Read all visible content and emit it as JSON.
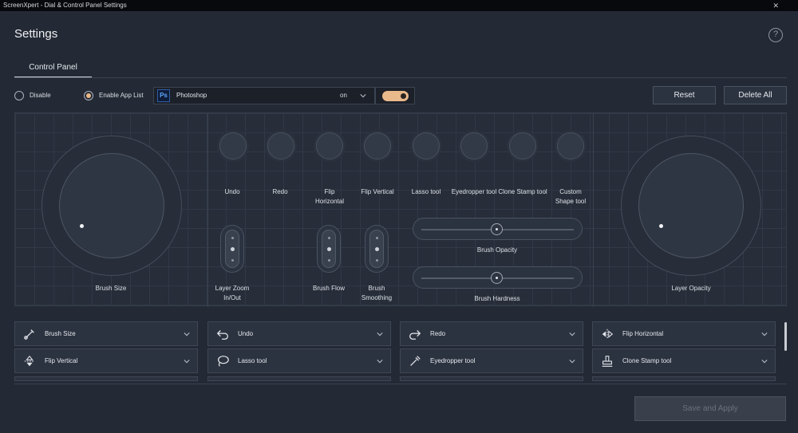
{
  "window": {
    "title": "ScreenXpert - Dial & Control Panel Settings",
    "close_glyph": "✕"
  },
  "header": {
    "title": "Settings",
    "help_glyph": "?"
  },
  "tabs": [
    {
      "label": "Control Panel"
    }
  ],
  "mode": {
    "disable_label": "Disable",
    "enable_app_list_label": "Enable App List",
    "selected": "Enable App List"
  },
  "app_select": {
    "icon_text": "Ps",
    "value": "Photoshop",
    "state": "on"
  },
  "toggle": {
    "on": true
  },
  "buttons": {
    "reset": "Reset",
    "delete_all": "Delete All",
    "save_apply": "Save and Apply"
  },
  "panel": {
    "left_dial": {
      "label": "Brush Size"
    },
    "right_dial": {
      "label": "Layer Opacity"
    },
    "knobs": [
      {
        "label": "Undo"
      },
      {
        "label": "Redo"
      },
      {
        "label": "Flip Horizontal"
      },
      {
        "label": "Flip Vertical"
      },
      {
        "label": "Lasso tool"
      },
      {
        "label": "Eyedropper tool"
      },
      {
        "label": "Clone Stamp tool"
      },
      {
        "label": "Custom Shape tool"
      }
    ],
    "vertical_sliders": [
      {
        "label": "Layer Zoom In/Out"
      },
      {
        "label": "Brush Flow"
      },
      {
        "label": "Brush Smoothing"
      }
    ],
    "horizontal_sliders": [
      {
        "label": "Brush Opacity"
      },
      {
        "label": "Brush Hardness"
      }
    ]
  },
  "mapping": [
    {
      "label": "Brush Size",
      "icon": "brush-icon"
    },
    {
      "label": "Undo",
      "icon": "undo-icon"
    },
    {
      "label": "Redo",
      "icon": "redo-icon"
    },
    {
      "label": "Flip Horizontal",
      "icon": "flip-horizontal-icon"
    },
    {
      "label": "Flip Vertical",
      "icon": "flip-vertical-icon"
    },
    {
      "label": "Lasso tool",
      "icon": "lasso-icon"
    },
    {
      "label": "Eyedropper tool",
      "icon": "eyedropper-icon"
    },
    {
      "label": "Clone Stamp tool",
      "icon": "stamp-icon"
    }
  ],
  "colors": {
    "accent": "#e8b98a",
    "background": "#242a35",
    "titlebar": "#07090c"
  }
}
